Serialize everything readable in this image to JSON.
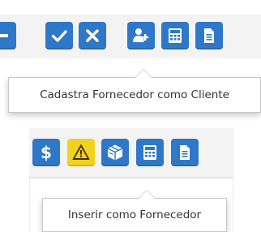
{
  "panel_1": {
    "toolbar": {
      "buttons": [
        {
          "icon": "minus-icon",
          "color": "#2f78c9"
        },
        {
          "icon": "checkmark-icon",
          "color": "#2f78c9"
        },
        {
          "icon": "close-icon",
          "color": "#2f78c9"
        },
        {
          "icon": "add-user-icon",
          "color": "#2f78c9"
        },
        {
          "icon": "calculator-icon",
          "color": "#2f78c9"
        },
        {
          "icon": "document-icon",
          "color": "#2f78c9"
        }
      ]
    },
    "tooltip": {
      "text": "Cadastra Fornecedor como Cliente"
    }
  },
  "panel_2": {
    "toolbar": {
      "buttons": [
        {
          "icon": "dollar-icon",
          "label": "$",
          "color": "#2f78c9"
        },
        {
          "icon": "warning-icon",
          "color": "#f2d21c"
        },
        {
          "icon": "box-icon",
          "color": "#2f78c9"
        },
        {
          "icon": "calculator-icon",
          "color": "#2f78c9"
        },
        {
          "icon": "document-icon",
          "color": "#2f78c9"
        }
      ]
    },
    "tooltip": {
      "text": "Inserir como Fornecedor"
    }
  },
  "colors": {
    "button_blue": "#2f78c9",
    "button_yellow": "#f2d21c",
    "toolbar_bg": "#f3f3f3",
    "tooltip_border": "#c8c8c8"
  }
}
